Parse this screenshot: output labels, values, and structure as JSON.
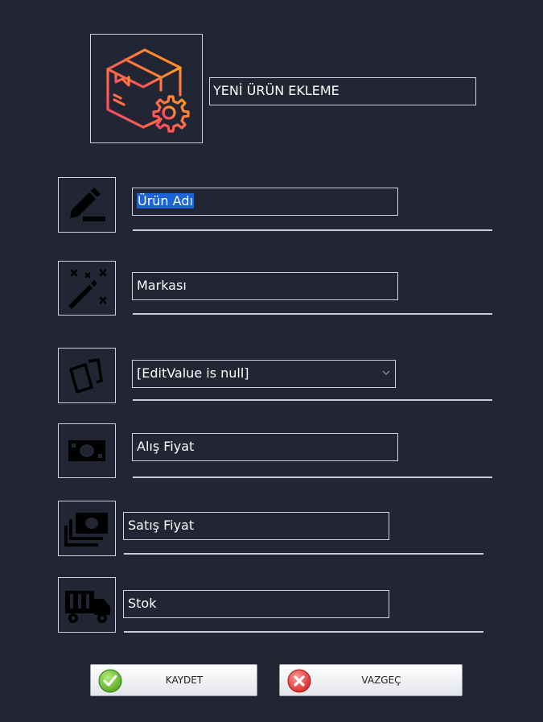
{
  "header": {
    "title": "YENİ ÜRÜN EKLEME",
    "logo_icon": "box-gear-icon",
    "accent_gradient": [
      "#ff3d6a",
      "#ff9f1c"
    ]
  },
  "form": {
    "product_name": {
      "value": "Ürün Adı",
      "icon": "pencil-icon"
    },
    "brand": {
      "value": "Markası",
      "icon": "magic-wand-icon"
    },
    "category": {
      "value": "[EditValue is null]",
      "icon": "cards-icon"
    },
    "purchase_price": {
      "value": "Alış Fiyat",
      "icon": "cash-icon"
    },
    "sale_price": {
      "value": "Satış Fiyat",
      "icon": "money-stack-icon"
    },
    "stock": {
      "value": "Stok",
      "icon": "truck-icon"
    }
  },
  "buttons": {
    "save": {
      "label": "KAYDET",
      "icon": "check-icon",
      "color": "#5cb82a"
    },
    "cancel": {
      "label": "VAZGEÇ",
      "icon": "x-icon",
      "color": "#e63939"
    }
  },
  "colors": {
    "background": "#222533",
    "border": "#cfd2da",
    "selection": "#1c63d6"
  }
}
